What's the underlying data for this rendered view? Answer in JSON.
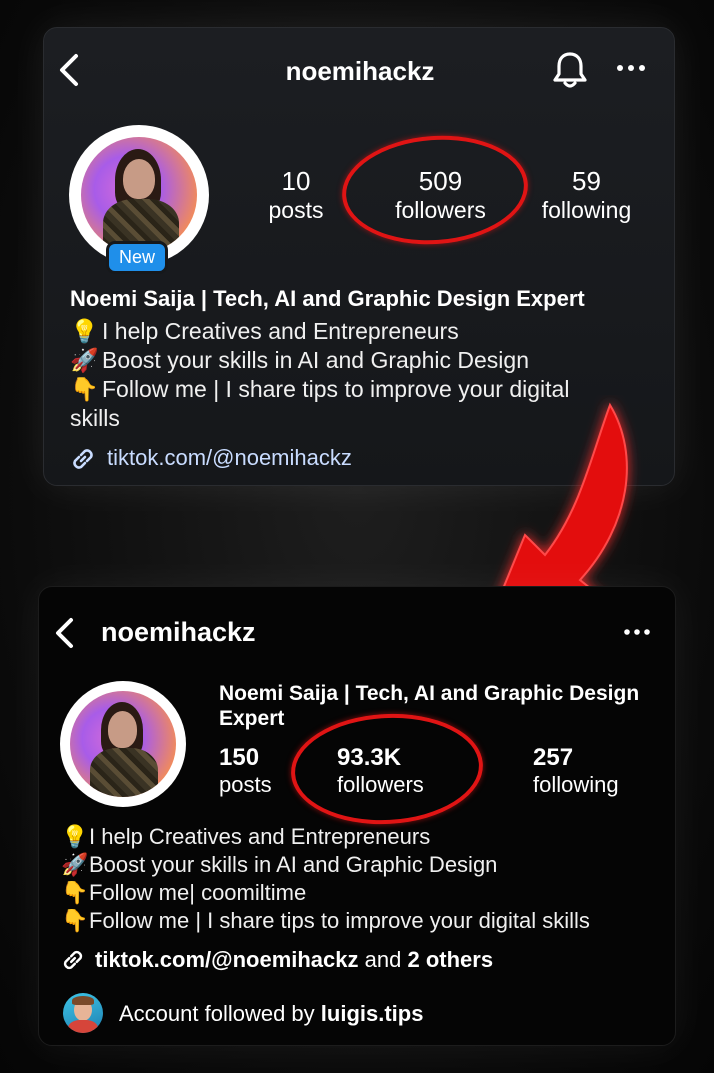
{
  "before": {
    "username": "noemihackz",
    "badge": "New",
    "stats": [
      {
        "value": "10",
        "label": "posts"
      },
      {
        "value": "509",
        "label": "followers"
      },
      {
        "value": "59",
        "label": "following"
      }
    ],
    "display_name": "Noemi Saija | Tech, AI and Graphic Design Expert",
    "bio": [
      {
        "emoji": "💡",
        "text": "I help Creatives and Entrepreneurs"
      },
      {
        "emoji": "🚀",
        "text": "Boost your skills in AI and Graphic Design"
      },
      {
        "emoji": "👇",
        "text": "Follow me | I share tips to improve your digital"
      }
    ],
    "bio_wrap": "skills",
    "link": "tiktok.com/@noemihackz",
    "icons": [
      "back-icon",
      "bell-icon",
      "more-icon",
      "link-icon"
    ]
  },
  "after": {
    "username": "noemihackz",
    "display_name_line1": "Noemi Saija | Tech, AI and Graphic Design",
    "display_name_line2": "Expert",
    "stats": [
      {
        "value": "150",
        "label": "posts"
      },
      {
        "value": "93.3K",
        "label": "followers"
      },
      {
        "value": "257",
        "label": "following"
      }
    ],
    "bio": [
      {
        "emoji": "💡",
        "text": "I help Creatives and Entrepreneurs"
      },
      {
        "emoji": "🚀",
        "text": "Boost your skills in AI and Graphic Design"
      },
      {
        "emoji": "👇",
        "text": "Follow me| coomiltime"
      },
      {
        "emoji": "👇",
        "text": "Follow me | I share tips to improve your digital skills"
      }
    ],
    "link": "tiktok.com/@noemihackz",
    "link_suffix_and": "and",
    "link_suffix_others": "2 others",
    "followed_by_prefix": "Account followed by",
    "followed_by_user": "luigis.tips",
    "icons": [
      "back-icon",
      "more-icon",
      "link-icon"
    ]
  },
  "colors": {
    "highlight_ring": "#e01414",
    "badge_blue": "#1f8fea",
    "arrow_red": "#e30f0f"
  }
}
